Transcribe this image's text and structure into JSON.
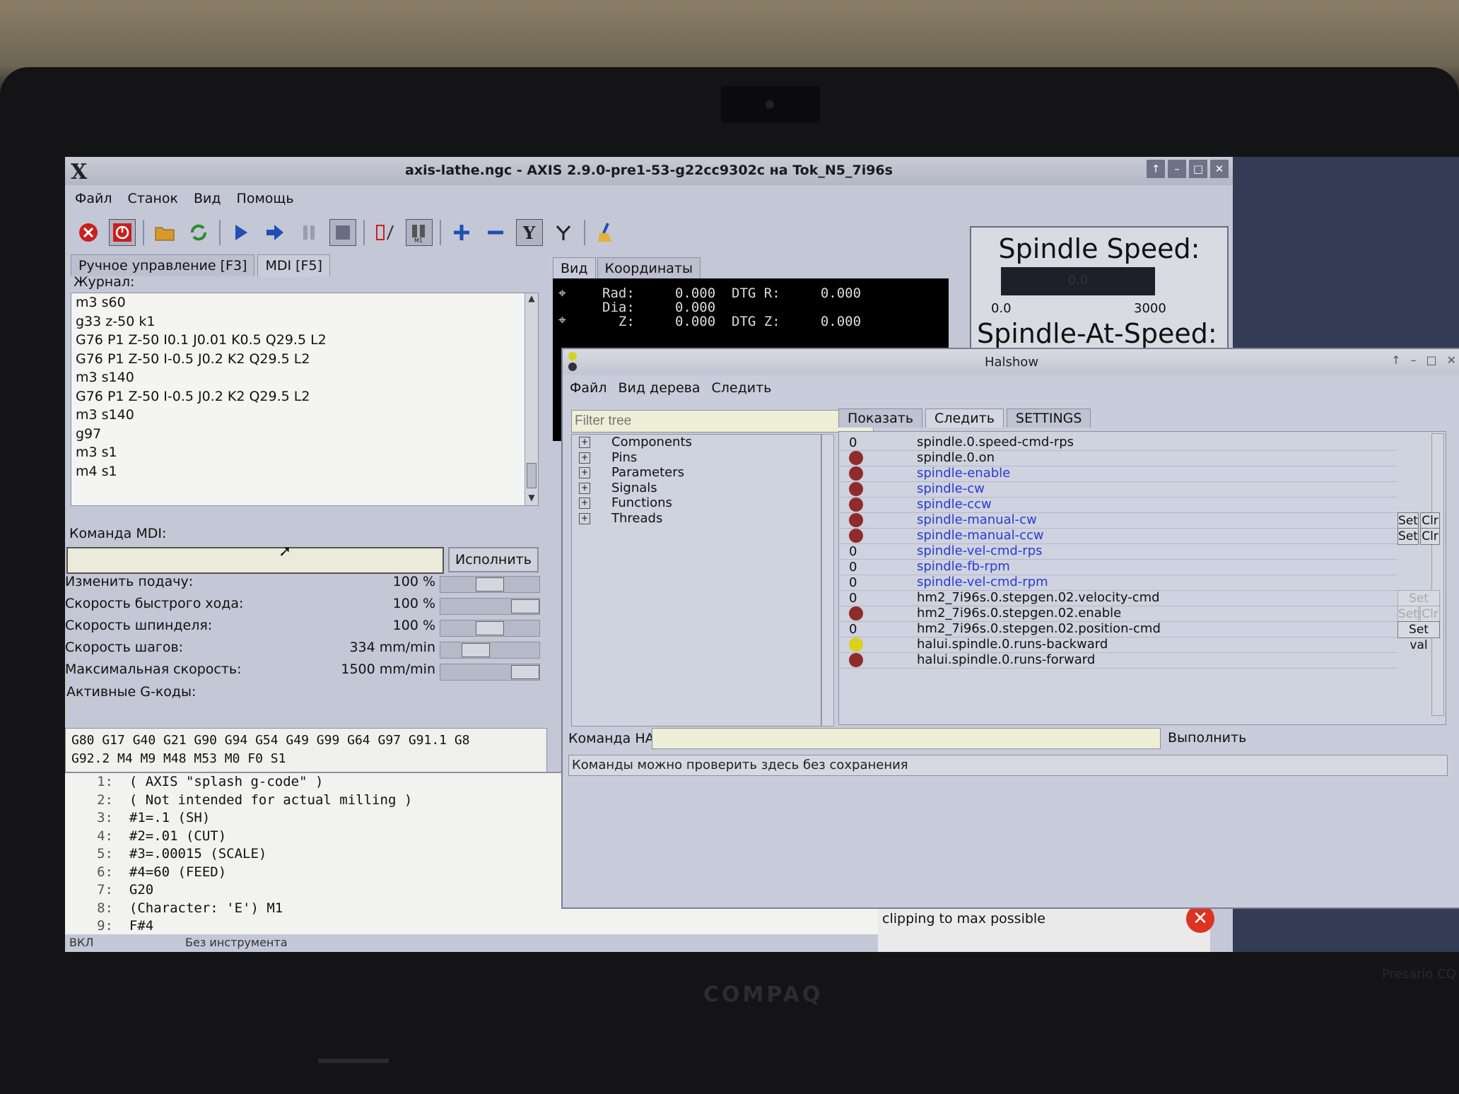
{
  "axis": {
    "title": "axis-lathe.ngc - AXIS 2.9.0-pre1-53-g22cc9302c на Tok_N5_7i96s",
    "menu": [
      "Файл",
      "Станок",
      "Вид",
      "Помощь"
    ],
    "tabs_left": [
      "Ручное управление [F3]",
      "MDI [F5]"
    ],
    "journal_label": "Журнал:",
    "journal": [
      "m3 s60",
      "g33 z-50 k1",
      "G76 P1 Z-50 I0.1 J0.01 K0.5 Q29.5 L2",
      "G76 P1 Z-50 I-0.5 J0.2 K2 Q29.5 L2",
      "m3 s140",
      "G76 P1 Z-50 I-0.5 J0.2 K2 Q29.5 L2",
      "m3 s140",
      "g97",
      "m3 s1",
      "m4 s1"
    ],
    "mdi_label": "Команда MDI:",
    "execute_label": "Исполнить",
    "overrides": [
      {
        "name": "Изменить подачу:",
        "value": "100 %",
        "level": 0.5
      },
      {
        "name": "Скорость быстрого хода:",
        "value": "100 %",
        "level": 1.0
      },
      {
        "name": "Скорость шпинделя:",
        "value": "100 %",
        "level": 0.5
      },
      {
        "name": "Скорость шагов:",
        "value": "334 mm/min",
        "level": 0.3
      },
      {
        "name": "Максимальная скорость:",
        "value": "1500 mm/min",
        "level": 1.0
      }
    ],
    "gcodes_label": "Активные G-коды:",
    "gcodes": "G80 G17 G40 G21 G90 G94 G54 G49 G99 G64 G97 G91.1 G8\nG92.2 M4 M9 M48 M53 M0 F0 S1",
    "tabs_right": [
      "Вид",
      "Координаты"
    ],
    "dro": [
      "Rad:     0.000  DTG R:     0.000",
      "Dia:     0.000",
      "  Z:     0.000  DTG Z:     0.000"
    ],
    "program": [
      {
        "n": "1:",
        "t": "( AXIS \"splash g-code\" )"
      },
      {
        "n": "2:",
        "t": "( Not intended for actual milling )"
      },
      {
        "n": "3:",
        "t": "#1=.1 (SH)"
      },
      {
        "n": "4:",
        "t": "#2=.01 (CUT)"
      },
      {
        "n": "5:",
        "t": "#3=.00015 (SCALE)"
      },
      {
        "n": "6:",
        "t": "#4=60 (FEED)"
      },
      {
        "n": "7:",
        "t": "G20"
      },
      {
        "n": "8:",
        "t": "(Character: 'E') M1"
      },
      {
        "n": "9:",
        "t": "F#4"
      }
    ],
    "spindle": {
      "title": "Spindle Speed:",
      "value": "0.0",
      "min": "0.0",
      "max": "3000",
      "at_speed": "Spindle-At-Speed:"
    },
    "notification": "big for current step timings & position scale,\nclipping to max possible",
    "status": [
      "ВКЛ",
      "Без инструмента"
    ]
  },
  "halshow": {
    "title": "Halshow",
    "menu": [
      "Файл",
      "Вид дерева",
      "Следить"
    ],
    "filter_placeholder": "Filter tree",
    "tree": [
      "Components",
      "Pins",
      "Parameters",
      "Signals",
      "Functions",
      "Threads"
    ],
    "tabs": [
      "Показать",
      "Следить",
      "SETTINGS"
    ],
    "watch": [
      {
        "type": "value",
        "value": "0",
        "name": "spindle.0.speed-cmd-rps",
        "kind": "pin"
      },
      {
        "type": "led",
        "color": "#8e2b2b",
        "name": "spindle.0.on",
        "kind": "pin"
      },
      {
        "type": "led",
        "color": "#8e2b2b",
        "name": "spindle-enable",
        "kind": "signal"
      },
      {
        "type": "led",
        "color": "#8e2b2b",
        "name": "spindle-cw",
        "kind": "signal"
      },
      {
        "type": "led",
        "color": "#8e2b2b",
        "name": "spindle-ccw",
        "kind": "signal"
      },
      {
        "type": "led",
        "color": "#8e2b2b",
        "name": "spindle-manual-cw",
        "kind": "signal",
        "buttons": "setclr"
      },
      {
        "type": "led",
        "color": "#8e2b2b",
        "name": "spindle-manual-ccw",
        "kind": "signal",
        "buttons": "setclr"
      },
      {
        "type": "value",
        "value": "0",
        "name": "spindle-vel-cmd-rps",
        "kind": "signal"
      },
      {
        "type": "value",
        "value": "0",
        "name": "spindle-fb-rpm",
        "kind": "signal"
      },
      {
        "type": "value",
        "value": "0",
        "name": "spindle-vel-cmd-rpm",
        "kind": "signal"
      },
      {
        "type": "value",
        "value": "0",
        "name": "hm2_7i96s.0.stepgen.02.velocity-cmd",
        "kind": "pin",
        "buttons": "setval-dis"
      },
      {
        "type": "led",
        "color": "#8e2b2b",
        "name": "hm2_7i96s.0.stepgen.02.enable",
        "kind": "pin",
        "buttons": "setclr-dis"
      },
      {
        "type": "value",
        "value": "0",
        "name": "hm2_7i96s.0.stepgen.02.position-cmd",
        "kind": "pin",
        "buttons": "setval"
      },
      {
        "type": "led",
        "color": "#d8d21c",
        "name": "halui.spindle.0.runs-backward",
        "kind": "pin"
      },
      {
        "type": "led",
        "color": "#8e2b2b",
        "name": "halui.spindle.0.runs-forward",
        "kind": "pin"
      }
    ],
    "btn_set": "Set",
    "btn_clr": "Clr",
    "btn_setval": "Set val",
    "cmd_label": "Команда HAL:",
    "cmd_button": "Выполнить",
    "cmd_output": "Команды можно проверить здесь без сохранения"
  },
  "laptop": {
    "brand": "COMPAQ",
    "model": "Presario CQ"
  }
}
